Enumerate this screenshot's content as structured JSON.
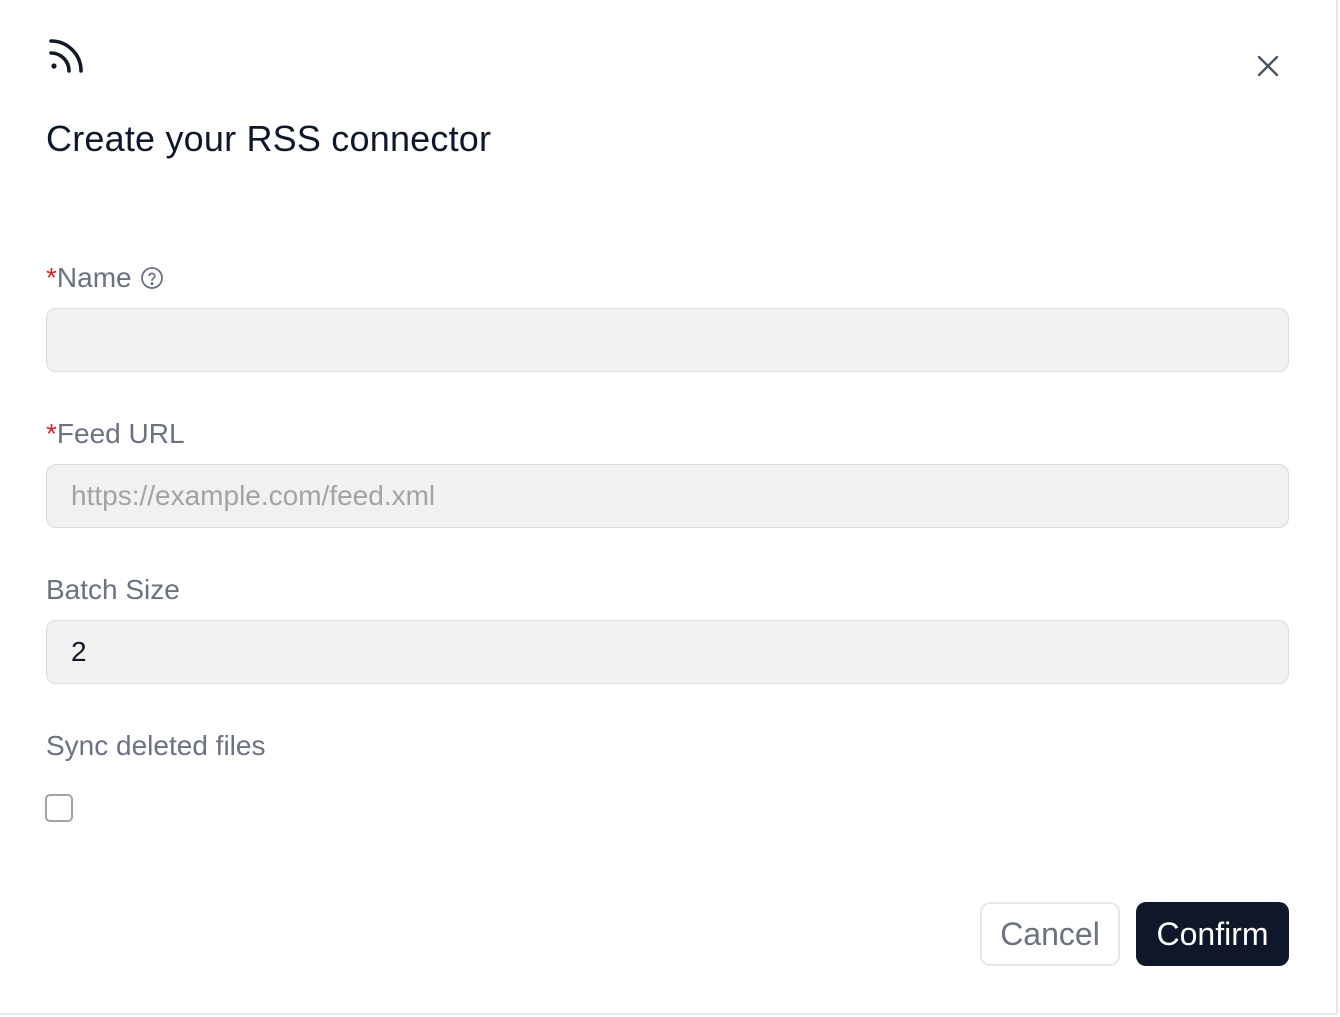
{
  "dialog": {
    "icon": "rss-icon",
    "title": "Create your RSS connector",
    "close_icon": "close-icon"
  },
  "form": {
    "name": {
      "required_mark": "*",
      "label": "Name",
      "help_icon": "help-circle-icon",
      "value": "",
      "placeholder": ""
    },
    "feed_url": {
      "required_mark": "*",
      "label": "Feed URL",
      "value": "",
      "placeholder": "https://example.com/feed.xml"
    },
    "batch_size": {
      "label": "Batch Size",
      "value": "2"
    },
    "sync_deleted_files": {
      "label": "Sync deleted files",
      "checked": false
    }
  },
  "footer": {
    "cancel_label": "Cancel",
    "confirm_label": "Confirm"
  },
  "colors": {
    "primary": "#0f172a",
    "required": "#dc2626",
    "input_bg": "#f1f1f1"
  }
}
